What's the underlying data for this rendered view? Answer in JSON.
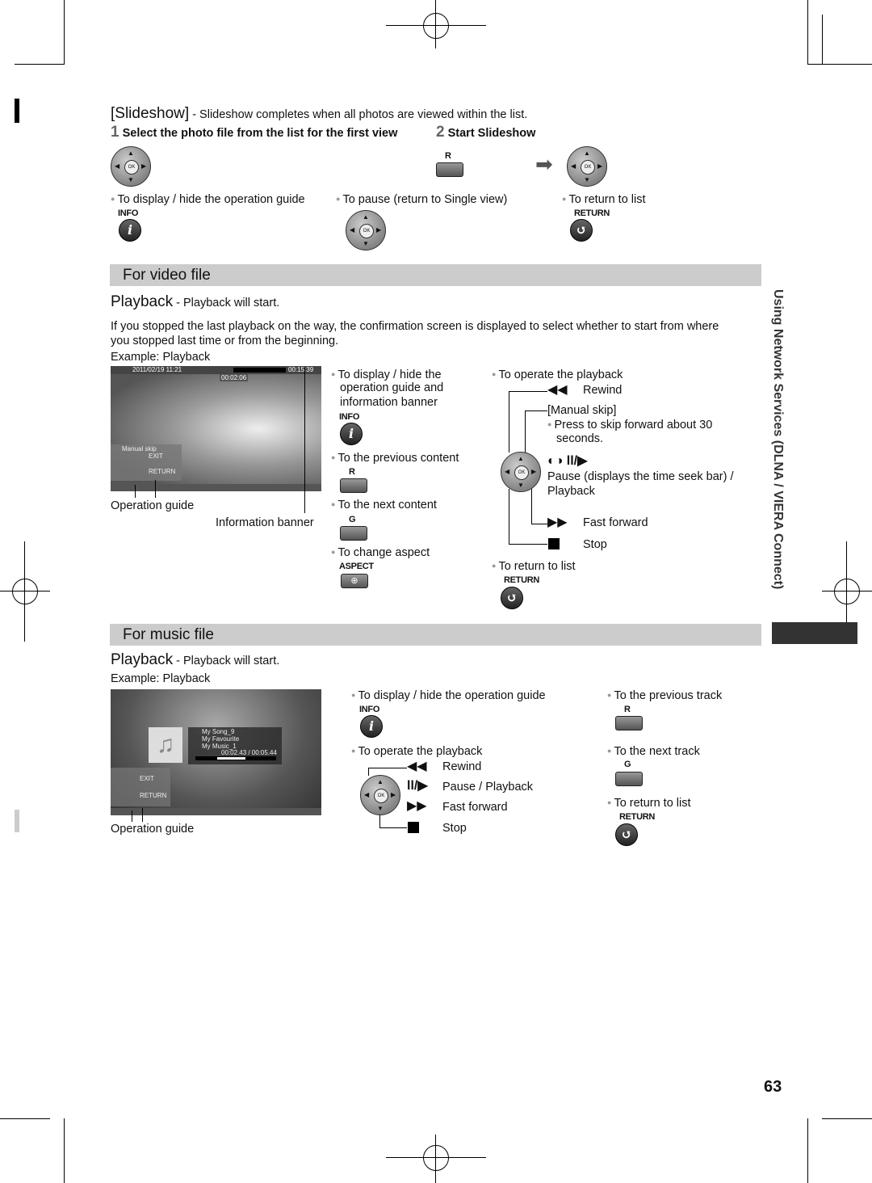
{
  "slideshow": {
    "title": "[Slideshow]",
    "desc": " - Slideshow completes when all photos are viewed within the list.",
    "step1_num": "1",
    "step1": "Select the photo file from the list for the first view",
    "step2_num": "2",
    "step2": "Start Slideshow",
    "r_label": "R",
    "ok": "OK",
    "guide": "To display / hide the operation guide",
    "info": "INFO",
    "pause": "To pause (return to Single view)",
    "ret": "To return to list",
    "return": "RETURN"
  },
  "video": {
    "section": "For video file",
    "playback": "Playback",
    "playback_desc": " - Playback will start.",
    "para": "If you stopped the last playback on the way, the confirmation screen is displayed to select whether to start from where",
    "para2": "you stopped last time or from the beginning.",
    "example": "Example: Playback",
    "screen": {
      "date": "2011/02/19 11:21",
      "elapsed": "00:02:06",
      "total": "00:15:39",
      "manual_skip": "Manual skip",
      "exit": "EXIT",
      "return": "RETURN"
    },
    "operation_guide": "Operation guide",
    "info_banner": "Information banner",
    "guide1": "To display / hide the",
    "guide2": "operation guide and",
    "guide3": "information banner",
    "info": "INFO",
    "prev": "To the previous content",
    "r": "R",
    "next": "To the next content",
    "g": "G",
    "aspect": "To change aspect",
    "aspect_label": "ASPECT",
    "operate": "To operate the playback",
    "rewind": "Rewind",
    "manual_skip": "[Manual skip]",
    "skip1": "Press to skip forward about 30",
    "skip2": "seconds.",
    "pause1": "Pause (displays the time seek bar) /",
    "pause2": "Playback",
    "ff": "Fast forward",
    "stop": "Stop",
    "ret": "To return to list",
    "return": "RETURN"
  },
  "music": {
    "section": "For music file",
    "playback": "Playback",
    "playback_desc": " - Playback will start.",
    "example": "Example: Playback",
    "screen": {
      "song": "My Song_9",
      "album": "My Favourite",
      "artist": "My Music_1",
      "time": "00:02.43 / 00:05.44",
      "exit": "EXIT",
      "return": "RETURN"
    },
    "operation_guide": "Operation guide",
    "guide": "To display / hide the operation guide",
    "info": "INFO",
    "operate": "To operate the playback",
    "rewind": "Rewind",
    "pause": "Pause / Playback",
    "ff": "Fast forward",
    "stop": "Stop",
    "prev": "To the previous track",
    "r": "R",
    "next": "To the next track",
    "g": "G",
    "ret": "To return to list",
    "return": "RETURN"
  },
  "side_tab": "Using Network Services (DLNA / VIERA Connect)",
  "page_number": "63"
}
